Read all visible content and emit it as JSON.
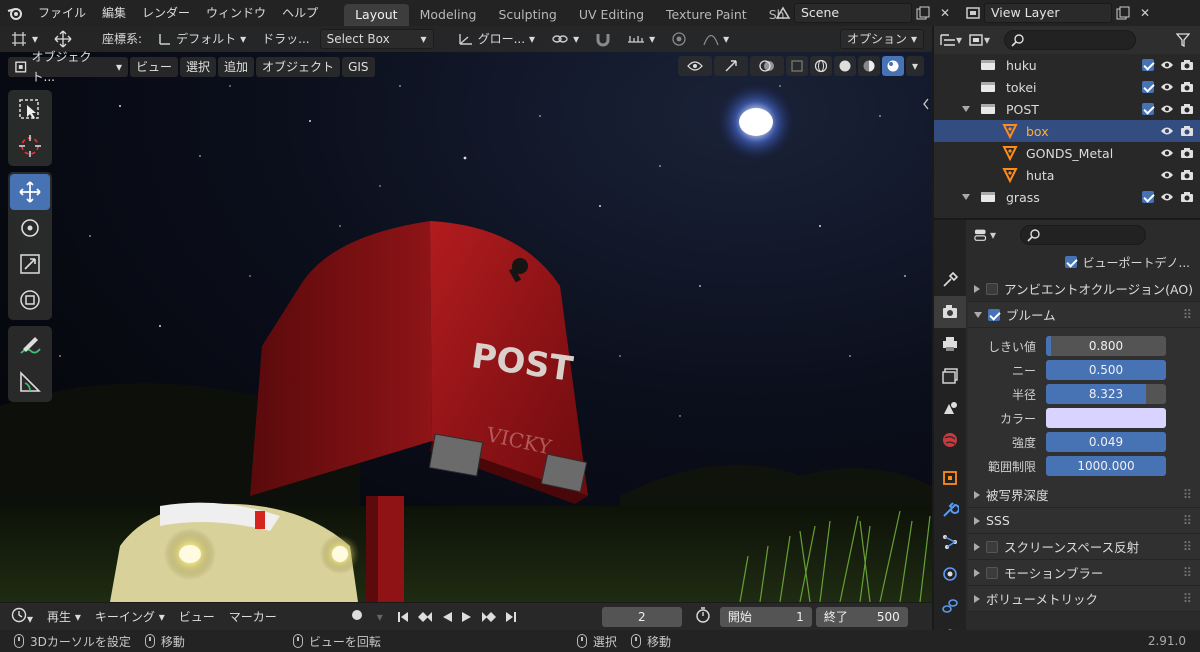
{
  "app": {
    "menu": [
      "ファイル",
      "編集",
      "レンダー",
      "ウィンドウ",
      "ヘルプ"
    ]
  },
  "workspaces": [
    "Layout",
    "Modeling",
    "Sculpting",
    "UV Editing",
    "Texture Paint",
    "Sh"
  ],
  "scene": {
    "name": "Scene",
    "view_layer": "View Layer"
  },
  "tool_header": {
    "coord_label": "座標系:",
    "coord_value": "デフォルト",
    "drag_label": "ドラッ...",
    "select_mode": "Select Box",
    "transform_orientation": "グロー...",
    "options": "オプション"
  },
  "viewport_header": {
    "mode": "オブジェクト...",
    "menus": [
      "ビュー",
      "選択",
      "追加",
      "オブジェクト",
      "GIS"
    ]
  },
  "mailbox": {
    "text": "POST",
    "engraving": "VICKY"
  },
  "timeline": {
    "playback": "再生",
    "keying": "キーイング",
    "view": "ビュー",
    "marker": "マーカー",
    "current_frame": "2",
    "start_label": "開始",
    "start": "1",
    "end_label": "終了",
    "end": "500"
  },
  "status": {
    "set_cursor": "3Dカーソルを設定",
    "move": "移動",
    "rotate_view": "ビューを回転",
    "select": "選択",
    "move2": "移動",
    "version": "2.91.0"
  },
  "outliner": {
    "rows": [
      {
        "name": "huku",
        "type": "collection"
      },
      {
        "name": "tokei",
        "type": "collection"
      },
      {
        "name": "POST",
        "type": "collection"
      },
      {
        "name": "box",
        "type": "mesh",
        "selected": true
      },
      {
        "name": "GONDS_Metal",
        "type": "mesh"
      },
      {
        "name": "huta",
        "type": "mesh"
      },
      {
        "name": "grass",
        "type": "collection"
      }
    ]
  },
  "properties": {
    "viewport_denoise": "ビューポートデノ...",
    "ambient_occlusion": "アンビエントオクルージョン(AO)",
    "bloom": "ブルーム",
    "bloom_fields": [
      {
        "label": "しきい値",
        "value": "0.800",
        "fraction": 0.04
      },
      {
        "label": "ニー",
        "value": "0.500",
        "fraction": 1.0
      },
      {
        "label": "半径",
        "value": "8.323",
        "fraction": 0.83
      },
      {
        "label": "カラー",
        "value": "",
        "fraction": 0
      },
      {
        "label": "強度",
        "value": "0.049",
        "fraction": 1.0
      },
      {
        "label": "範囲制限",
        "value": "1000.000",
        "fraction": 1.0
      }
    ],
    "bloom_color": "#d9d4ff",
    "panels": [
      "被写界深度",
      "SSS",
      "スクリーンスペース反射",
      "モーションブラー",
      "ボリューメトリック"
    ]
  },
  "colors": {
    "accent": "#4772b3",
    "selection_text": "#ffaf29",
    "mailbox_red": "#a3161a"
  }
}
